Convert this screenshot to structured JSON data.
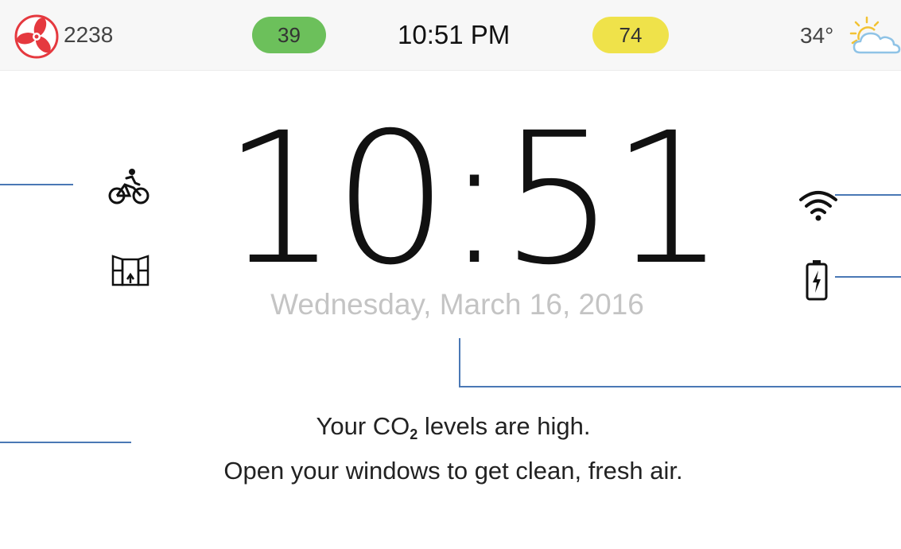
{
  "status_bar": {
    "fan_count": "2238",
    "indoor_value": "39",
    "time": "10:51 PM",
    "outdoor_value": "74",
    "temperature": "34°",
    "weather_icon": "partly-cloudy-icon"
  },
  "main": {
    "clock": "10:51",
    "date": "Wednesday, March 16, 2016"
  },
  "message": {
    "line1_before": "Your CO",
    "line1_sub": "2",
    "line1_after": " levels are high.",
    "line2": "Open your windows to get clean, fresh air."
  },
  "icons": {
    "left": [
      "bicycle-icon",
      "open-window-icon"
    ],
    "right": [
      "wifi-icon",
      "battery-charging-icon"
    ]
  },
  "colors": {
    "fan": "#e5393f",
    "indoor_pill": "#6cc05b",
    "outdoor_pill": "#efe24a",
    "callout_line": "#4a78b5",
    "sun": "#f2c233",
    "cloud": "#8fc3e6"
  }
}
